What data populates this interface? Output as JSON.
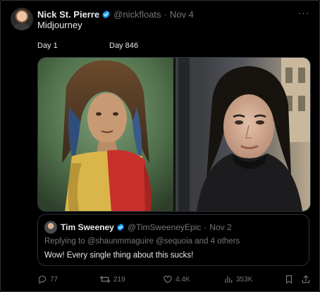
{
  "tweet": {
    "author_name": "Nick St. Pierre",
    "handle": "@nickfloats",
    "separator": "·",
    "date": "Nov 4",
    "more_label": "···",
    "text": "Midjourney",
    "image_labels": [
      "Day 1",
      "Day 846"
    ]
  },
  "quoted": {
    "author_name": "Tim Sweeney",
    "handle": "@TimSweeneyEpic",
    "separator": "·",
    "date": "Nov 2",
    "replying_to": "Replying to @shaunmmaguire @sequoia and 4 others",
    "text": "Wow! Every single thing about this sucks!"
  },
  "actions": {
    "replies": "77",
    "retweets": "219",
    "likes": "4.4K",
    "views": "353K"
  },
  "colors": {
    "verified": "#1d9bf0",
    "muted": "#71767b",
    "border": "#2f3336"
  },
  "icons": [
    "verified-badge-icon",
    "more-icon",
    "reply-icon",
    "retweet-icon",
    "like-icon",
    "views-icon",
    "bookmark-icon",
    "share-icon"
  ]
}
